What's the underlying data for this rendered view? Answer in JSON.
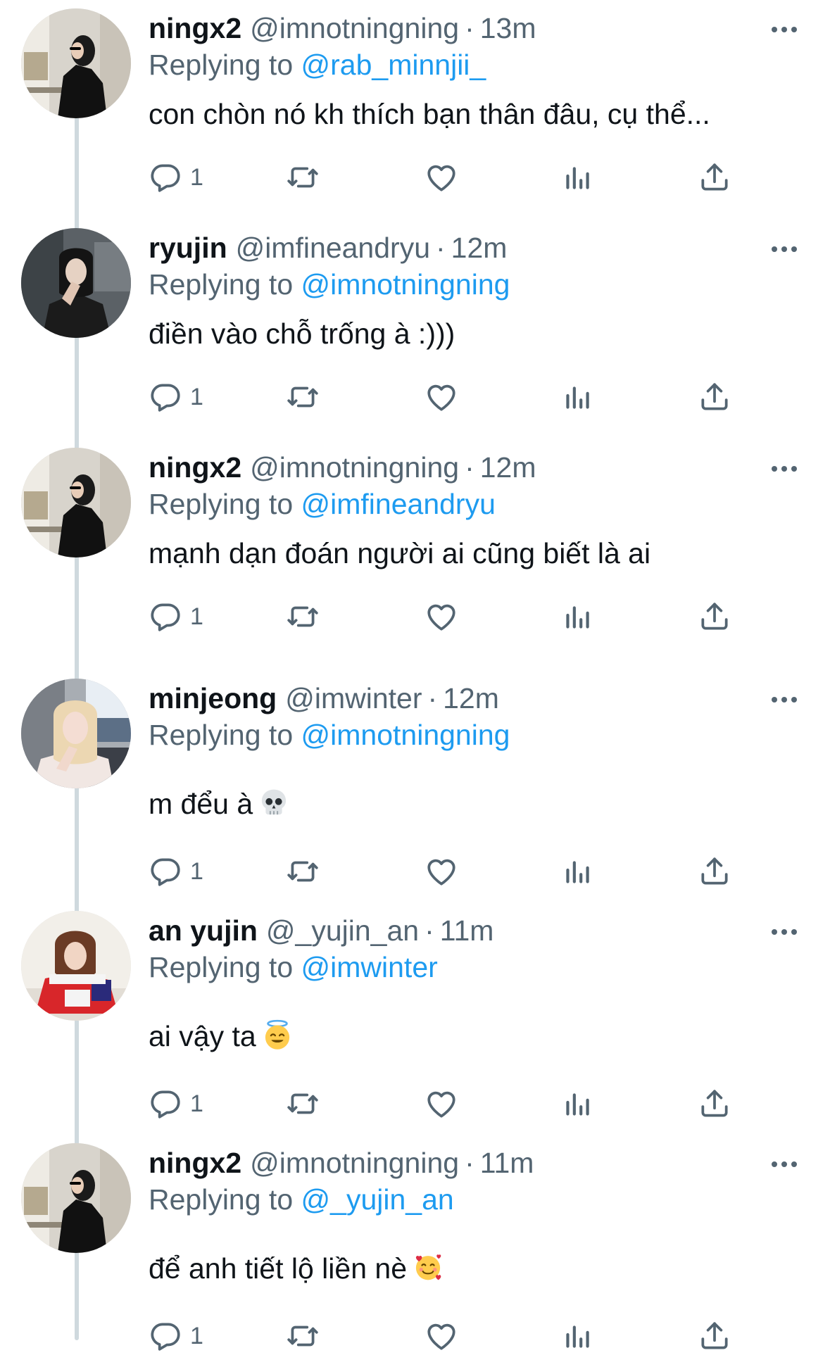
{
  "tweets": [
    {
      "name": "ningx2",
      "handle": "@imnotningning",
      "dot": "·",
      "time": "13m",
      "replying_prefix": "Replying to",
      "replying_to": "@rab_minnjii_",
      "text": "con chòn nó kh thích bạn thân đâu, cụ thể...",
      "emoji": "",
      "reply_count": "1",
      "avatar": "avatar-ningx2"
    },
    {
      "name": "ryujin",
      "handle": "@imfineandryu",
      "dot": "·",
      "time": "12m",
      "replying_prefix": "Replying to",
      "replying_to": "@imnotningning",
      "text": "điền vào chỗ trống à :)))",
      "emoji": "",
      "reply_count": "1",
      "avatar": "avatar-ryujin"
    },
    {
      "name": "ningx2",
      "handle": "@imnotningning",
      "dot": "·",
      "time": "12m",
      "replying_prefix": "Replying to",
      "replying_to": "@imfineandryu",
      "text": "mạnh dạn đoán người ai cũng biết là ai",
      "emoji": "",
      "reply_count": "1",
      "avatar": "avatar-ningx2"
    },
    {
      "name": "minjeong",
      "handle": "@imwinter",
      "dot": "·",
      "time": "12m",
      "replying_prefix": "Replying to",
      "replying_to": "@imnotningning",
      "text": "m đểu à",
      "emoji": "skull-emoji",
      "reply_count": "1",
      "avatar": "avatar-minjeong"
    },
    {
      "name": "an yujin",
      "handle": "@_yujin_an",
      "dot": "·",
      "time": "11m",
      "replying_prefix": "Replying to",
      "replying_to": "@imwinter",
      "text": "ai vậy ta",
      "emoji": "halo-smile-emoji",
      "reply_count": "1",
      "avatar": "avatar-anyujin"
    },
    {
      "name": "ningx2",
      "handle": "@imnotningning",
      "dot": "·",
      "time": "11m",
      "replying_prefix": "Replying to",
      "replying_to": "@_yujin_an",
      "text": "để anh tiết lộ liền nè",
      "emoji": "smiling-hearts-emoji",
      "reply_count": "1",
      "avatar": "avatar-ningx2"
    }
  ],
  "icons": {
    "reply": "reply-icon",
    "retweet": "retweet-icon",
    "like": "heart-icon",
    "views": "analytics-icon",
    "share": "share-icon",
    "more": "more-icon"
  },
  "colors": {
    "link": "#1d9bf0",
    "secondary": "#536471",
    "text": "#0f1419",
    "thread_line": "#cfd9de"
  }
}
